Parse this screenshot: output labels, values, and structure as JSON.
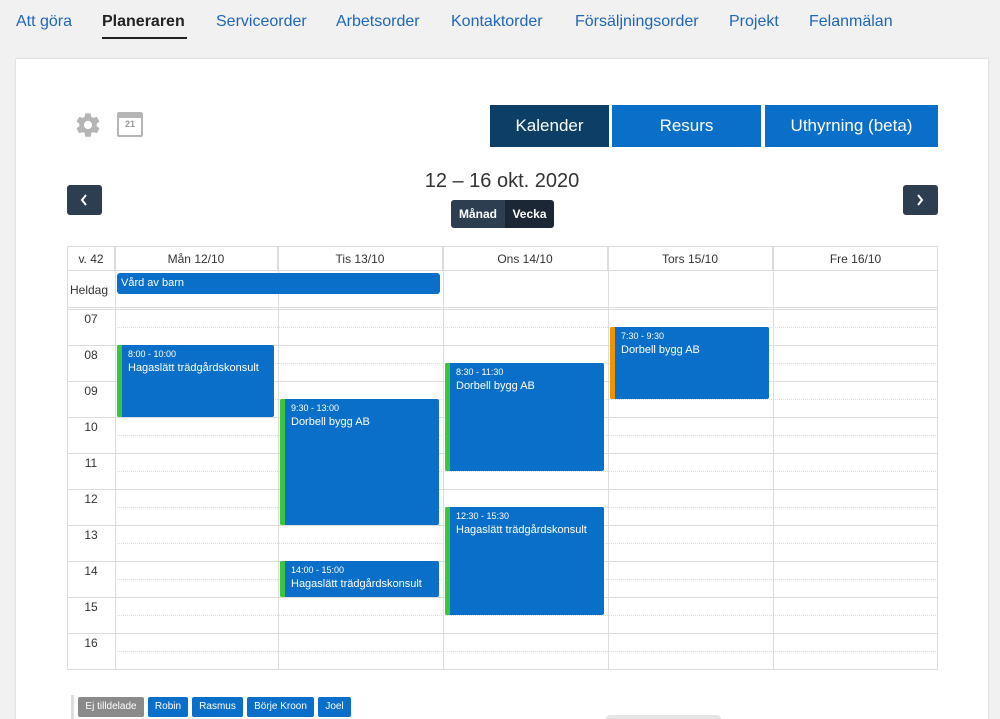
{
  "nav": {
    "items": [
      "Att göra",
      "Planeraren",
      "Serviceorder",
      "Arbetsorder",
      "Kontaktorder",
      "Försäljningsorder",
      "Projekt",
      "Felanmälan"
    ],
    "active": "Planeraren"
  },
  "toolbar": {
    "calendar_icon_text": "21",
    "view_buttons": [
      "Kalender",
      "Resurs",
      "Uthyrning (beta)"
    ],
    "active_view": "Kalender"
  },
  "header": {
    "range": "12 – 16 okt. 2020",
    "mode_month": "Månad",
    "mode_week": "Vecka",
    "active_mode": "Vecka"
  },
  "calendar": {
    "week_label": "v. 42",
    "allday_label": "Heldag",
    "days": [
      "Mån 12/10",
      "Tis 13/10",
      "Ons 14/10",
      "Tors 15/10",
      "Fre 16/10"
    ],
    "hours": [
      "07",
      "08",
      "09",
      "10",
      "11",
      "12",
      "13",
      "14",
      "15",
      "16"
    ],
    "allday_events": [
      {
        "title": "Vård av barn",
        "start_day": 0,
        "end_day": 1
      }
    ],
    "events": [
      {
        "day": 0,
        "time": "8:00 - 10:00",
        "title": "Hagaslätt trädgårdskonsult",
        "start": 8.0,
        "end": 10.0,
        "stripe": "#3cc43c"
      },
      {
        "day": 1,
        "time": "9:30 - 13:00",
        "title": "Dorbell bygg AB",
        "start": 9.5,
        "end": 13.0,
        "stripe": "#3cc43c"
      },
      {
        "day": 1,
        "time": "14:00 - 15:00",
        "title": "Hagaslätt trädgårdskonsult",
        "start": 14.0,
        "end": 15.0,
        "stripe": "#3cc43c"
      },
      {
        "day": 2,
        "time": "8:30 - 11:30",
        "title": "Dorbell bygg AB",
        "start": 8.5,
        "end": 11.5,
        "stripe": "#3cc43c"
      },
      {
        "day": 2,
        "time": "12:30 - 15:30",
        "title": "Hagaslätt trädgårdskonsult",
        "start": 12.5,
        "end": 15.5,
        "stripe": "#3cc43c"
      },
      {
        "day": 3,
        "time": "7:30 - 9:30",
        "title": "Dorbell bygg AB",
        "start": 7.5,
        "end": 9.5,
        "stripe": "#f39200"
      }
    ]
  },
  "resources": [
    {
      "label": "Ej tilldelade",
      "style": "muted"
    },
    {
      "label": "Robin",
      "style": "blue"
    },
    {
      "label": "Rasmus",
      "style": "blue"
    },
    {
      "label": "Börje Kroon",
      "style": "blue"
    },
    {
      "label": "Joel",
      "style": "blue"
    }
  ],
  "colors": {
    "accent": "#0a6fc9",
    "dark": "#0d3e66",
    "stripe_green": "#3cc43c",
    "stripe_orange": "#f39200"
  }
}
